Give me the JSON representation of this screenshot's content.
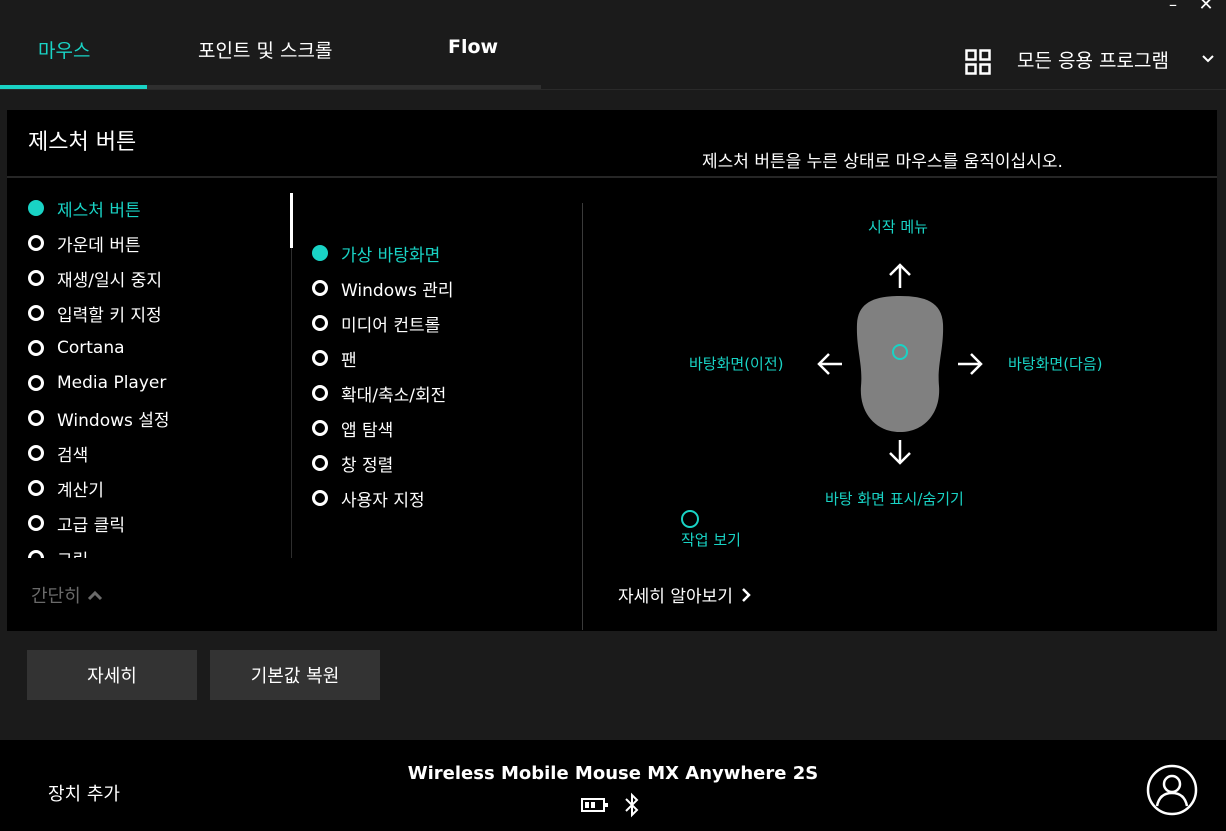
{
  "window": {
    "minimize": "–",
    "close": "✕"
  },
  "tabs": [
    {
      "label": "마우스",
      "active": true
    },
    {
      "label": "포인트 및 스크롤",
      "active": false
    },
    {
      "label": "Flow",
      "active": false
    }
  ],
  "apps_selector": {
    "label": "모든 응용 프로그램",
    "icon": "apps-grid-icon"
  },
  "panel": {
    "title": "제스처 버튼",
    "instruction": "제스처 버튼을 누른 상태로 마우스를 움직이십시오.",
    "buttons_list": [
      {
        "label": "제스처 버튼",
        "selected": true
      },
      {
        "label": "가운데 버튼",
        "selected": false
      },
      {
        "label": "재생/일시 중지",
        "selected": false
      },
      {
        "label": "입력할 키 지정",
        "selected": false
      },
      {
        "label": "Cortana",
        "selected": false
      },
      {
        "label": "Media Player",
        "selected": false
      },
      {
        "label": "Windows 설정",
        "selected": false
      },
      {
        "label": "검색",
        "selected": false
      },
      {
        "label": "계산기",
        "selected": false
      },
      {
        "label": "고급 클릭",
        "selected": false
      },
      {
        "label": "그림",
        "selected": false
      }
    ],
    "gesture_list": [
      {
        "label": "가상 바탕화면",
        "selected": true
      },
      {
        "label": "Windows 관리",
        "selected": false
      },
      {
        "label": "미디어 컨트롤",
        "selected": false
      },
      {
        "label": "팬",
        "selected": false
      },
      {
        "label": "확대/축소/회전",
        "selected": false
      },
      {
        "label": "앱 탐색",
        "selected": false
      },
      {
        "label": "창 정렬",
        "selected": false
      },
      {
        "label": "사용자 지정",
        "selected": false
      }
    ],
    "collapse_label": "간단히",
    "diagram": {
      "up": "시작 메뉴",
      "left": "바탕화면(이전)",
      "right": "바탕화면(다음)",
      "down": "바탕 화면 표시/숨기기",
      "click": "작업 보기"
    },
    "learn_more": "자세히 알아보기"
  },
  "actions": {
    "details": "자세히",
    "restore_defaults": "기본값 복원"
  },
  "footer": {
    "add_device": "장치 추가",
    "device_name": "Wireless Mobile Mouse MX Anywhere 2S"
  },
  "colors": {
    "accent": "#19d3c5",
    "panel_bg": "#000000",
    "app_bg": "#1b1b1b",
    "button_bg": "#333333"
  }
}
